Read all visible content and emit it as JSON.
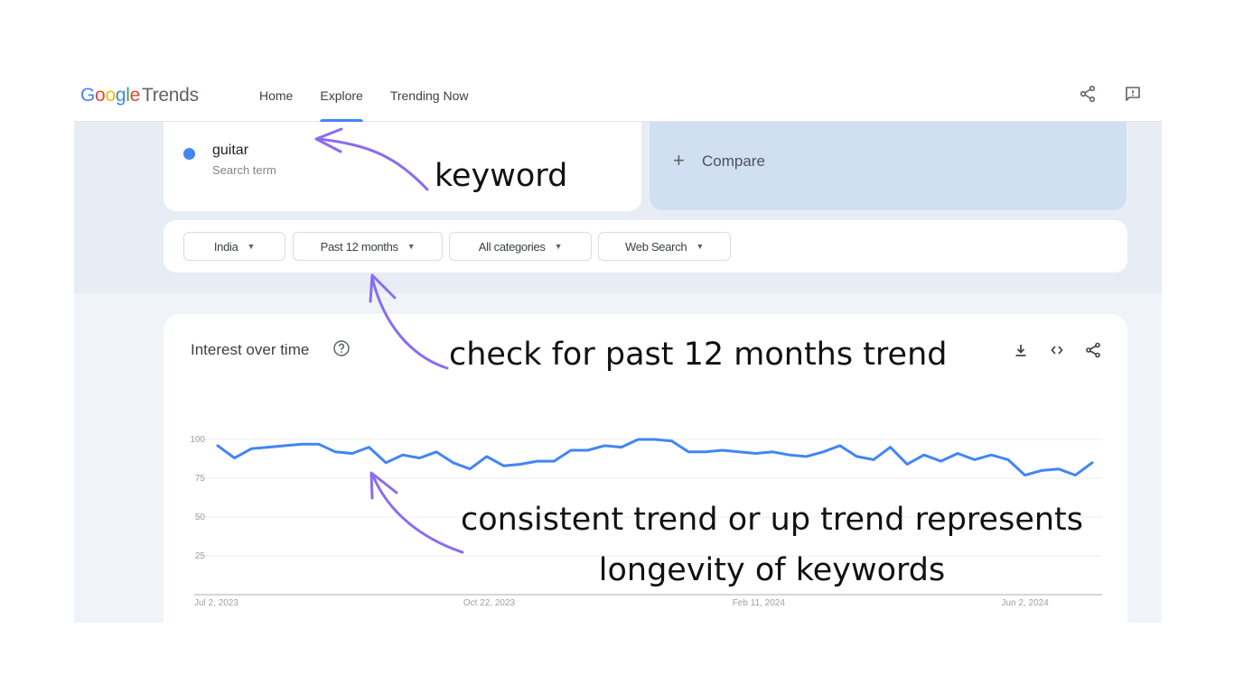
{
  "header": {
    "logo_google": "Google",
    "logo_product": "Trends",
    "nav": [
      {
        "label": "Home",
        "active": false
      },
      {
        "label": "Explore",
        "active": true
      },
      {
        "label": "Trending Now",
        "active": false
      }
    ],
    "icons": [
      "share-icon",
      "feedback-icon"
    ]
  },
  "search": {
    "term": "guitar",
    "term_type": "Search term",
    "term_color": "#4285f4",
    "compare_plus": "+",
    "compare_label": "Compare"
  },
  "filters": [
    {
      "label": "India"
    },
    {
      "label": "Past 12 months"
    },
    {
      "label": "All categories"
    },
    {
      "label": "Web Search"
    }
  ],
  "filter_caret": "▼",
  "chart_card": {
    "title": "Interest over time",
    "help_icon": "help-circle-icon",
    "actions": [
      "download-icon",
      "embed-icon",
      "share-icon"
    ]
  },
  "annotations": {
    "keyword": "keyword",
    "trend": "check for past 12 months trend",
    "longevity": "consistent trend or up trend represents longevity of keywords",
    "arrow_color": "#8b6cf0"
  },
  "chart_data": {
    "type": "line",
    "title": "Interest over time",
    "xlabel": "",
    "ylabel": "",
    "ylim": [
      0,
      100
    ],
    "yticks": [
      25,
      50,
      75,
      100
    ],
    "grid": true,
    "x_tick_labels": [
      "Jul 2, 2023",
      "Oct 22, 2023",
      "Feb 11, 2024",
      "Jun 2, 2024"
    ],
    "x_tick_indices": [
      0,
      16,
      32,
      48
    ],
    "series": [
      {
        "name": "guitar",
        "color": "#4285f4",
        "values": [
          96,
          88,
          94,
          95,
          96,
          97,
          97,
          92,
          91,
          95,
          85,
          90,
          88,
          92,
          85,
          81,
          89,
          83,
          84,
          86,
          86,
          93,
          93,
          96,
          95,
          100,
          100,
          99,
          92,
          92,
          93,
          92,
          91,
          92,
          90,
          89,
          92,
          96,
          89,
          87,
          95,
          84,
          90,
          86,
          91,
          87,
          90,
          87,
          77,
          80,
          81,
          77,
          85
        ]
      }
    ]
  }
}
